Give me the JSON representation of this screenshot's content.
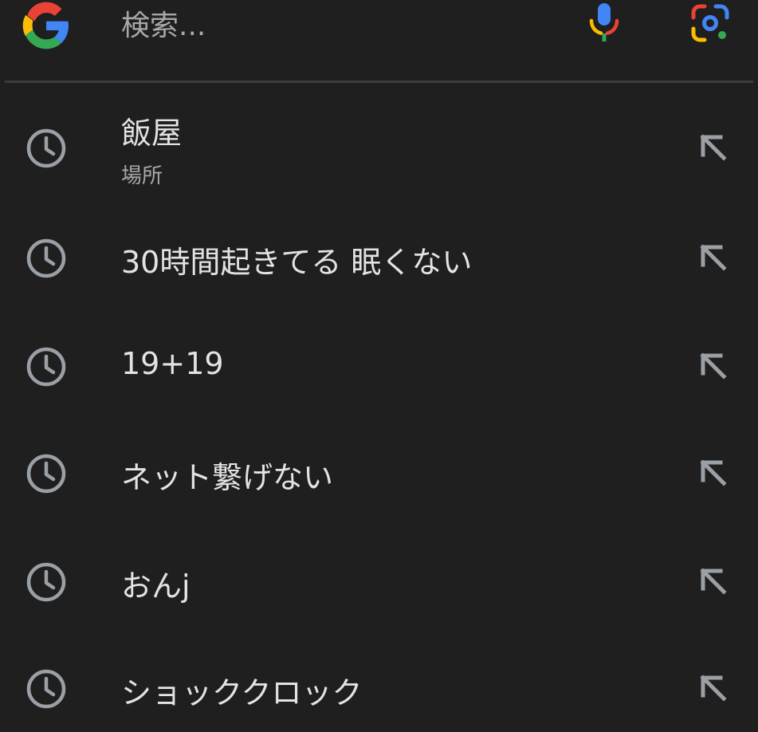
{
  "search": {
    "placeholder": "検索..."
  },
  "icons": {
    "logo": "google-g-logo",
    "mic": "microphone-icon",
    "lens": "google-lens-icon",
    "history": "clock-icon",
    "fill": "arrow-up-left-icon"
  },
  "colors": {
    "background": "#1f1f1f",
    "text": "#e3e3e3",
    "secondary_text": "#a8a8a8",
    "icon_gray": "#9aa0a6",
    "google_blue": "#4285f4",
    "google_red": "#ea4335",
    "google_yellow": "#fbbc04",
    "google_green": "#34a853"
  },
  "suggestions": [
    {
      "text": "飯屋",
      "subtitle": "場所"
    },
    {
      "text": "30時間起きてる 眠くない"
    },
    {
      "text": "19+19"
    },
    {
      "text": "ネット繋げない"
    },
    {
      "text": "おんj"
    },
    {
      "text": "ショッククロック"
    }
  ]
}
